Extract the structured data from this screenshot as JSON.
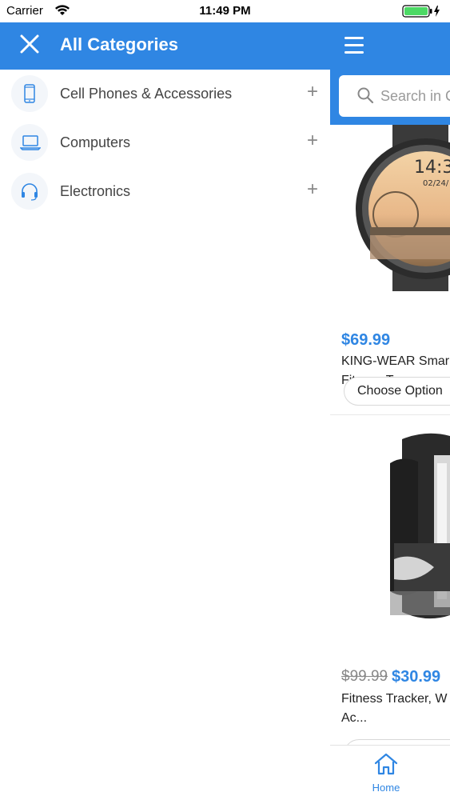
{
  "status_bar": {
    "carrier": "Carrier",
    "time": "11:49 PM"
  },
  "drawer": {
    "title": "All Categories",
    "categories": [
      {
        "label": "Cell Phones & Accessories",
        "icon": "phone-icon"
      },
      {
        "label": "Computers",
        "icon": "laptop-icon"
      },
      {
        "label": "Electronics",
        "icon": "headphones-icon"
      }
    ],
    "expand_symbol": "+"
  },
  "main": {
    "search_placeholder": "Search in C",
    "products": [
      {
        "price": "$69.99",
        "title_line1": "KING-WEAR Smar",
        "title_line2": "Fitness T...",
        "button": "Choose Option",
        "watch_time": "14:3",
        "watch_date": "02/24/"
      },
      {
        "old_price": "$99.99",
        "price": "$30.99",
        "title_line1": "Fitness Tracker, W",
        "title_line2": "Ac..."
      }
    ],
    "tabbar": {
      "home_label": "Home"
    }
  },
  "colors": {
    "accent": "#2f86e3"
  }
}
